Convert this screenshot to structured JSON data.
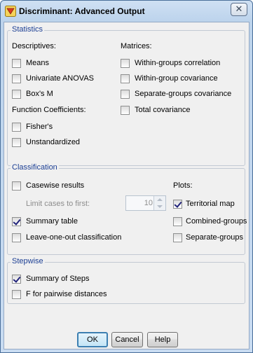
{
  "window": {
    "title": "Discriminant: Advanced Output",
    "close_glyph": "✕"
  },
  "statistics": {
    "legend": "Statistics",
    "descriptives": {
      "heading": "Descriptives:",
      "items": [
        {
          "label": "Means",
          "checked": false
        },
        {
          "label": "Univariate ANOVAS",
          "checked": false
        },
        {
          "label": "Box's M",
          "checked": false
        }
      ]
    },
    "function_coefficients": {
      "heading": "Function Coefficients:",
      "items": [
        {
          "label": "Fisher's",
          "checked": false
        },
        {
          "label": "Unstandardized",
          "checked": false
        }
      ]
    },
    "matrices": {
      "heading": "Matrices:",
      "items": [
        {
          "label": "Within-groups correlation",
          "checked": false
        },
        {
          "label": "Within-group covariance",
          "checked": false
        },
        {
          "label": "Separate-groups covariance",
          "checked": false
        },
        {
          "label": "Total covariance",
          "checked": false
        }
      ]
    }
  },
  "classification": {
    "legend": "Classification",
    "casewise": {
      "label": "Casewise results",
      "checked": false
    },
    "limit": {
      "label": "Limit cases to first:",
      "value": "10",
      "enabled": false
    },
    "summary_table": {
      "label": "Summary table",
      "checked": true
    },
    "leave_one_out": {
      "label": "Leave-one-out classification",
      "checked": false
    },
    "plots": {
      "heading": "Plots:",
      "items": [
        {
          "label": "Territorial map",
          "checked": true
        },
        {
          "label": "Combined-groups",
          "checked": false
        },
        {
          "label": "Separate-groups",
          "checked": false
        }
      ]
    }
  },
  "stepwise": {
    "legend": "Stepwise",
    "items": [
      {
        "label": "Summary of Steps",
        "checked": true
      },
      {
        "label": "F for pairwise distances",
        "checked": false
      }
    ]
  },
  "buttons": {
    "ok": "OK",
    "cancel": "Cancel",
    "help": "Help"
  },
  "colors": {
    "legend_text": "#1c3f94",
    "title_bar": "#bcd3ec",
    "default_button_border": "#3c7fb1",
    "check_mark": "#21237a"
  },
  "icons": {
    "app": "discriminant-app-icon",
    "close": "close-icon"
  }
}
